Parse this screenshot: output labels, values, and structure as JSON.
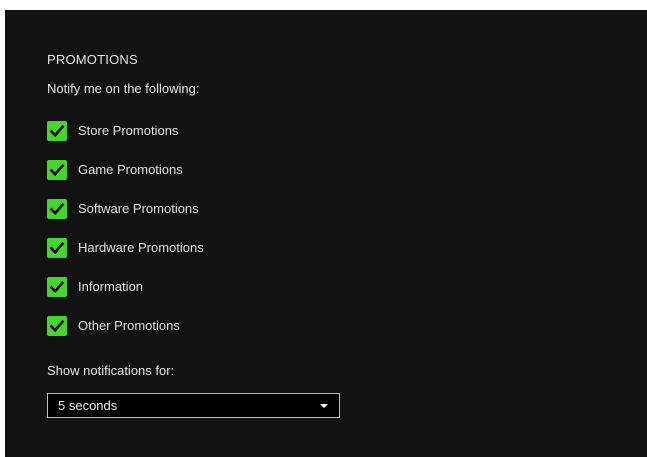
{
  "colors": {
    "background": "#121212",
    "checkbox_fill": "#44d62c",
    "checkmark": "#000000",
    "text": "#e6e6e6"
  },
  "section": {
    "title": "PROMOTIONS",
    "subtitle": "Notify me on the following:"
  },
  "options": [
    {
      "label": "Store Promotions",
      "checked": true
    },
    {
      "label": "Game Promotions",
      "checked": true
    },
    {
      "label": "Software Promotions",
      "checked": true
    },
    {
      "label": "Hardware Promotions",
      "checked": true
    },
    {
      "label": "Information",
      "checked": true
    },
    {
      "label": "Other Promotions",
      "checked": true
    }
  ],
  "notification_duration": {
    "label": "Show notifications for:",
    "selected": "5 seconds",
    "icon": "chevron-down-icon"
  }
}
